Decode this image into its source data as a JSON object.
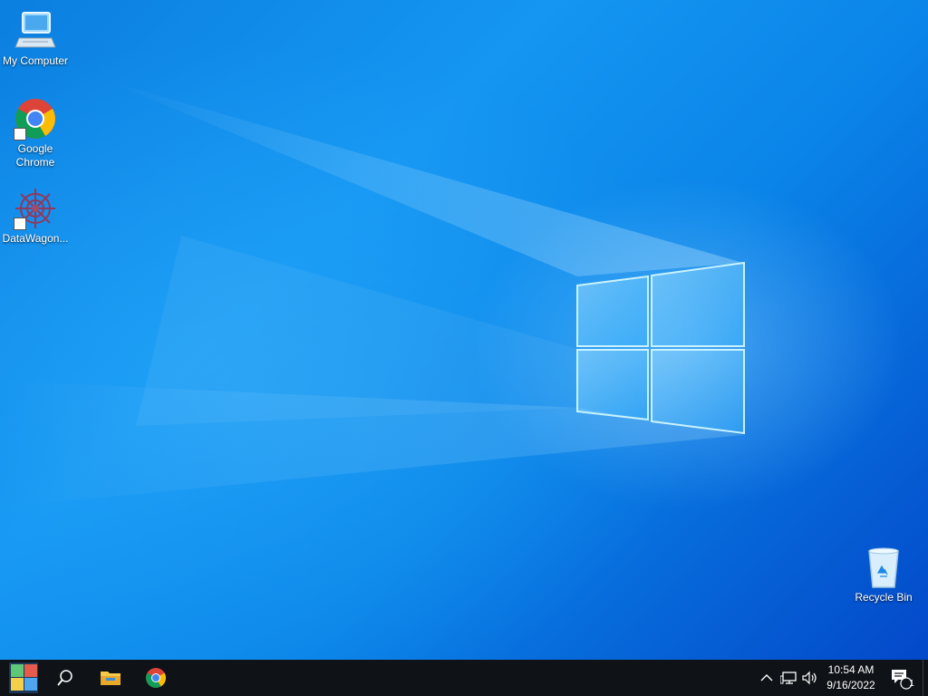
{
  "desktop": {
    "icons": [
      {
        "label": "My Computer",
        "icon": "computer-icon"
      },
      {
        "label": "Google\nChrome",
        "icon": "chrome-icon"
      },
      {
        "label": "DataWagon...",
        "icon": "datawagon-icon"
      },
      {
        "label": "Recycle Bin",
        "icon": "recycle-bin-icon"
      }
    ]
  },
  "taskbar": {
    "start": {
      "icon": "windows-start-icon"
    },
    "search": {
      "icon": "search-icon"
    },
    "pinned": [
      {
        "icon": "file-explorer-icon"
      },
      {
        "icon": "chrome-icon"
      }
    ],
    "tray": {
      "chevron_icon": "chevron-up-icon",
      "network_icon": "network-icon",
      "volume_icon": "volume-icon",
      "time": "10:54 AM",
      "date": "9/16/2022",
      "notifications_icon": "action-center-icon",
      "notification_count": "1"
    }
  },
  "colors": {
    "taskbar_bg": "#0f1216",
    "wallpaper_accent": "#0a84e8"
  }
}
